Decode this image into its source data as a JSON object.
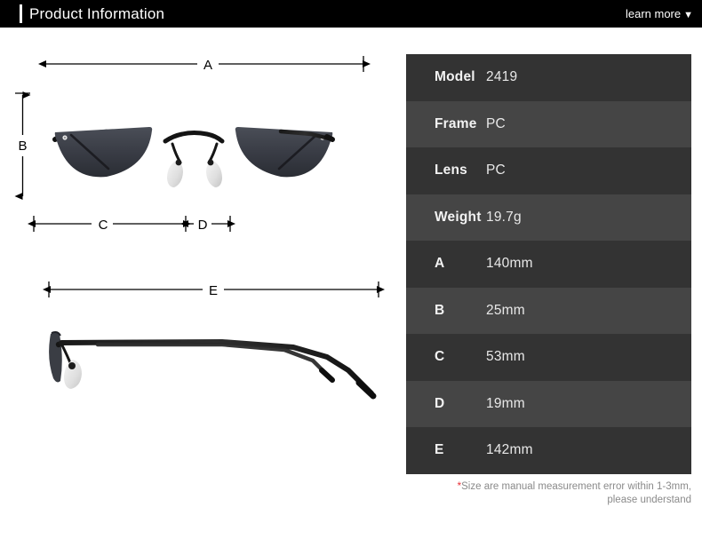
{
  "header": {
    "title": "Product Information",
    "learn_more_label": "learn more",
    "caret_icon": "chevron-down-icon",
    "background_color": "#000000",
    "accent_color": "#ffffff"
  },
  "diagram": {
    "front_view": {
      "name": "sunglasses-front-view",
      "description": "rimless cat-eye sunglasses, black temples, dark gray lenses, clear nose pads"
    },
    "side_view": {
      "name": "sunglasses-side-view",
      "description": "side profile of rimless sunglasses with long black temple arm"
    },
    "dimension_labels": {
      "a": "A",
      "b": "B",
      "c": "C",
      "d": "D",
      "e": "E"
    }
  },
  "spec_table": {
    "rows": [
      {
        "key": "Model",
        "value": "2419"
      },
      {
        "key": "Frame",
        "value": "PC"
      },
      {
        "key": "Lens",
        "value": "PC"
      },
      {
        "key": "Weight",
        "value": "19.7g"
      },
      {
        "key": "A",
        "value": "140mm"
      },
      {
        "key": "B",
        "value": "25mm"
      },
      {
        "key": "C",
        "value": "53mm"
      },
      {
        "key": "D",
        "value": "19mm"
      },
      {
        "key": "E",
        "value": "142mm"
      }
    ],
    "row_color_odd": "#333333",
    "row_color_even": "#454545"
  },
  "footnote": {
    "marker": "*",
    "line1": "Size are manual measurement error within 1-3mm,",
    "line2": "please understand",
    "marker_color": "#e8333a"
  }
}
